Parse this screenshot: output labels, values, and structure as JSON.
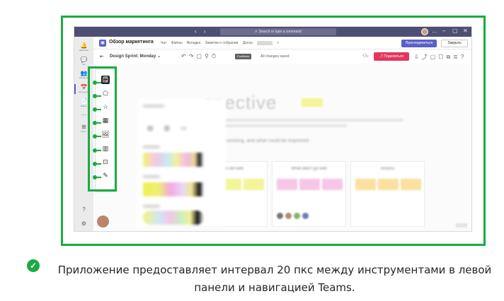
{
  "titlebar": {
    "nav_arrows": "‹ ›",
    "search_placeholder": "Search or type a command",
    "window_controls": [
      "…",
      "–",
      "▢",
      "✕"
    ]
  },
  "rail": [
    {
      "icon": "bell-icon",
      "glyph": "🔔",
      "label": "Действия"
    },
    {
      "icon": "chat-icon",
      "glyph": "💬",
      "label": "Чат"
    },
    {
      "icon": "teams-icon",
      "glyph": "👥",
      "label": "Команды"
    },
    {
      "icon": "calendar-icon",
      "glyph": "📅",
      "label": "Календарь",
      "active": true
    },
    {
      "icon": "files-icon",
      "glyph": "📄",
      "label": "Файлы"
    },
    {
      "icon": "more-icon",
      "glyph": "⋯",
      "label": ""
    },
    {
      "icon": "apps-icon",
      "glyph": "⊞",
      "label": "Прил."
    }
  ],
  "rail_bottom": [
    {
      "icon": "help-icon",
      "glyph": "?"
    },
    {
      "icon": "settings-icon",
      "glyph": "⚙"
    }
  ],
  "header": {
    "title": "Обзор маркетинга",
    "tabs": [
      "Чат",
      "Файлы",
      "Вкладка",
      "Заметки о собрании",
      "Доска"
    ],
    "add_tab": "+",
    "join_label": "Присоединиться",
    "close_label": "Закрыть"
  },
  "toolbar": {
    "doc_name": "Design Sprint: Monday",
    "badge": "Facilitator",
    "status": "All changes saved",
    "users_count": "2",
    "share_label": "Поделиться",
    "right_icons": [
      "⇩",
      "⤴",
      "▢",
      "☐",
      "⧉",
      "≣",
      "?"
    ]
  },
  "canvas": {
    "heading": "spective",
    "subline": "e team is working, and what could be improved",
    "columns": [
      {
        "heading": "Team did well"
      },
      {
        "heading": "What didn't go well"
      },
      {
        "heading": "Actions"
      }
    ]
  },
  "left_tools": [
    {
      "name": "sticky-note-tool",
      "glyph": "🗒"
    },
    {
      "name": "shapes-tool",
      "glyph": "⬠"
    },
    {
      "name": "reactions-tool",
      "glyph": "☆"
    },
    {
      "name": "table-tool",
      "glyph": "▦"
    },
    {
      "name": "image-tool",
      "glyph": "🖼"
    },
    {
      "name": "templates-tool",
      "glyph": "▥"
    },
    {
      "name": "insert-tool",
      "glyph": "⊡"
    },
    {
      "name": "pen-tool",
      "glyph": "✎"
    }
  ],
  "caption": {
    "line1": "Приложение предоставляет интервал 20 пкс между инструментами в левой",
    "line2": "панели и навигацией Teams."
  },
  "colors": {
    "highlight_border": "#1aab43",
    "teams_titlebar": "#4e4f74",
    "teams_accent": "#5b5fc7",
    "share_button": "#e3365e"
  }
}
